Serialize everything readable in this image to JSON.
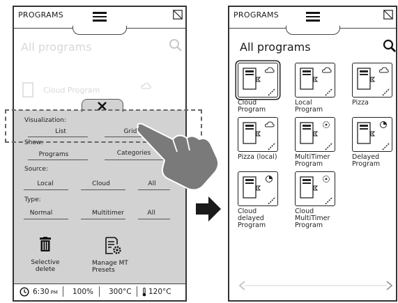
{
  "left_screen": {
    "title": "PROGRAMS",
    "heading": "All programs",
    "faded_item": "Cloud Program",
    "filter_panel": {
      "visualization_label": "Visualization:",
      "visualization_options": [
        "List",
        "Grid"
      ],
      "show_label": "Show:",
      "show_options": [
        "Programs",
        "Categories"
      ],
      "source_label": "Source:",
      "source_options": [
        "Local",
        "Cloud",
        "All"
      ],
      "type_label": "Type:",
      "type_options": [
        "Normal",
        "Multitimer",
        "All"
      ],
      "selective_delete": "Selective\ndelete",
      "manage_mt_presets": "Manage MT\nPresets"
    },
    "status_bar": {
      "time": "6:30",
      "time_suffix": "PM",
      "percent": "100%",
      "temp1": "300°C",
      "temp2": "120°C"
    }
  },
  "right_screen": {
    "title": "PROGRAMS",
    "heading": "All programs",
    "programs": [
      {
        "label": "Cloud\nProgram",
        "icon": "cloud-icon"
      },
      {
        "label": "Local\nProgram",
        "icon": "cloud-icon"
      },
      {
        "label": "Pizza",
        "icon": "cloud-icon"
      },
      {
        "label": "Pizza (local)",
        "icon": "cloud-icon"
      },
      {
        "label": "MultiTimer\nProgram",
        "icon": "multitimer-icon"
      },
      {
        "label": "Delayed\nProgram",
        "icon": "delayed-icon"
      },
      {
        "label": "Cloud\ndelayed Program",
        "icon": "delayed-icon"
      },
      {
        "label": "Cloud MultiTimer\nProgram",
        "icon": "multitimer-icon"
      }
    ]
  }
}
